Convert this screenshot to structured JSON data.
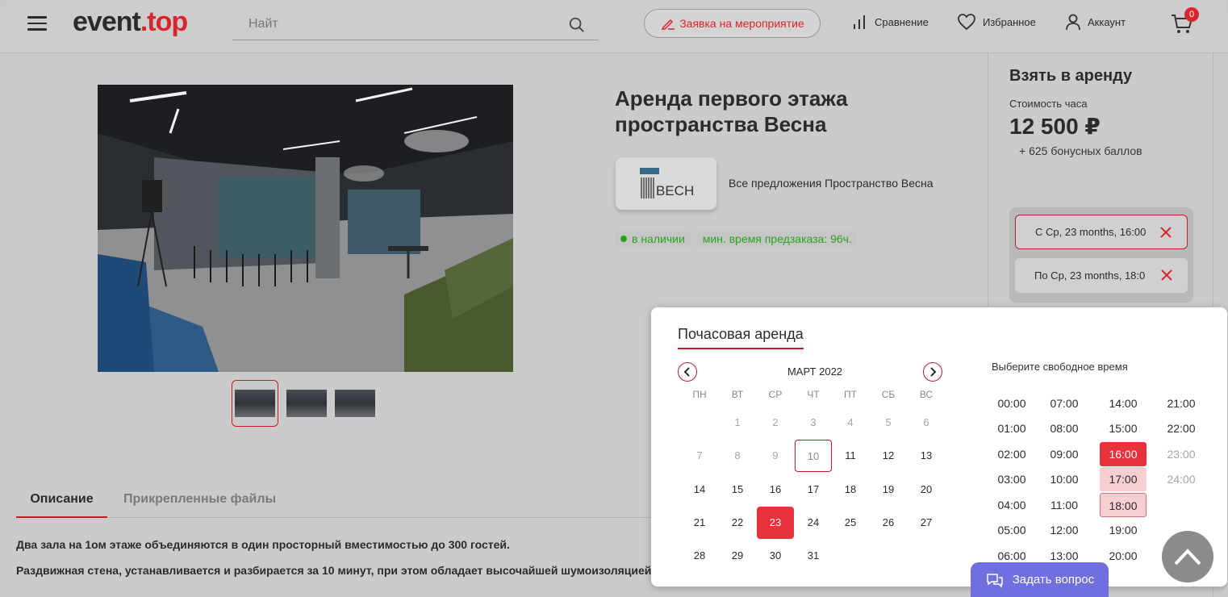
{
  "header": {
    "logo_main": "event",
    "logo_dot": ".",
    "logo_accent": "top",
    "search_placeholder": "Найт",
    "request_label": "Заявка на мероприятие",
    "compare_label": "Сравнение",
    "favorites_label": "Избранное",
    "account_label": "Аккаунт",
    "cart_count": "0"
  },
  "product": {
    "title": "Аренда первого этажа пространства Весна",
    "brand_link": "Все предложения Пространство Весна",
    "in_stock": "в наличии",
    "min_preorder": "мин. время предзаказа: 96ч."
  },
  "rent": {
    "title": "Взять в аренду",
    "price_label": "Стоимость часа",
    "price": "12 500 ₽",
    "bonus": "+ 625 бонусных баллов",
    "from": "С Ср, 23 months, 16:00",
    "to": "По Ср, 23 months, 18:0"
  },
  "tabs": {
    "description": "Описание",
    "files": "Прикрепленные файлы"
  },
  "description": {
    "line1": "Два зала на 1ом этаже объединяются в один просторный вместимостью до 300 гостей.",
    "line2": "Раздвижная стена, устанавливается и разбирается за 10 минут, при этом обладает высочайшей шумоизоляцией."
  },
  "calendar": {
    "title": "Почасовая аренда",
    "month": "МАРТ 2022",
    "weekdays": [
      "ПН",
      "ВТ",
      "СР",
      "ЧТ",
      "ПТ",
      "СБ",
      "ВС"
    ],
    "days": [
      [
        "",
        "1",
        "2",
        "3",
        "4",
        "5",
        "6"
      ],
      [
        "7",
        "8",
        "9",
        "10",
        "11",
        "12",
        "13"
      ],
      [
        "14",
        "15",
        "16",
        "17",
        "18",
        "19",
        "20"
      ],
      [
        "21",
        "22",
        "23",
        "24",
        "25",
        "26",
        "27"
      ],
      [
        "28",
        "29",
        "30",
        "31",
        "",
        "",
        ""
      ]
    ],
    "time_title": "Выберите свободное время",
    "times": [
      [
        "00:00",
        "07:00",
        "14:00",
        "21:00"
      ],
      [
        "01:00",
        "08:00",
        "15:00",
        "22:00"
      ],
      [
        "02:00",
        "09:00",
        "16:00",
        "23:00"
      ],
      [
        "03:00",
        "10:00",
        "17:00",
        "24:00"
      ],
      [
        "04:00",
        "11:00",
        "18:00",
        ""
      ],
      [
        "05:00",
        "12:00",
        "19:00",
        ""
      ],
      [
        "06:00",
        "13:00",
        "20:00",
        ""
      ]
    ]
  },
  "chat": {
    "ask_label": "Задать вопрос"
  },
  "brand_logo_text": "ВЕСНА",
  "colors": {
    "accent": "#d7262f",
    "stock": "#2ba21e",
    "chat": "#6f6fe0"
  }
}
